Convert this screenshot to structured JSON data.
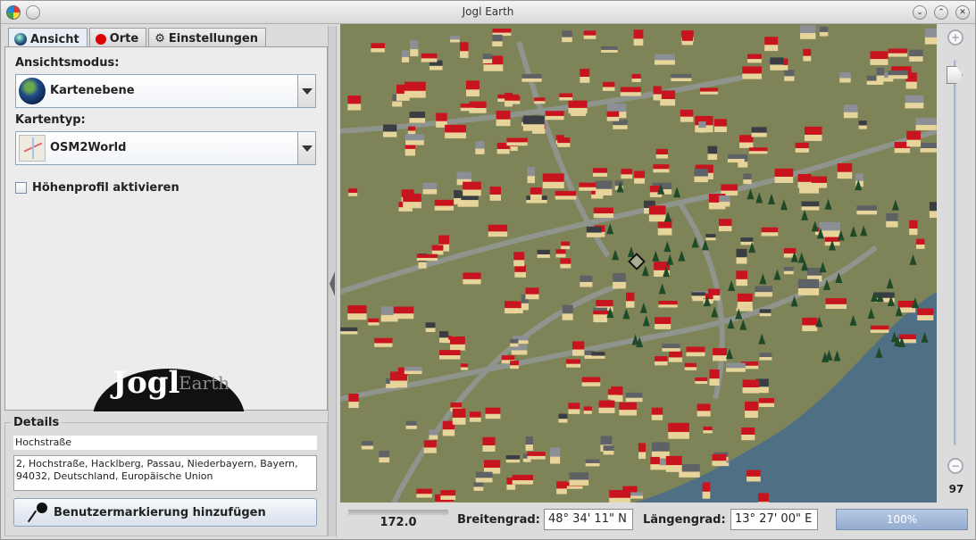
{
  "window": {
    "title": "Jogl Earth"
  },
  "tabs": [
    {
      "label": "Ansicht"
    },
    {
      "label": "Orte"
    },
    {
      "label": "Einstellungen"
    }
  ],
  "view": {
    "mode_label": "Ansichtsmodus:",
    "mode_value": "Kartenebene",
    "maptype_label": "Kartentyp:",
    "maptype_value": "OSM2World",
    "elevation_label": "Höhenprofil aktivieren",
    "elevation_checked": false
  },
  "logo": {
    "word1": "Jogl",
    "word2": "Earth"
  },
  "details": {
    "legend": "Details",
    "name": "Hochstraße",
    "address": "2, Hochstraße, Hacklberg, Passau, Niederbayern, Bayern, 94032, Deutschland, Europäische Union",
    "add_marker_label": "Benutzermarkierung hinzufügen"
  },
  "zoom": {
    "value": "97",
    "slider_fraction": 0.97
  },
  "statusbar": {
    "scale_value": "172.0",
    "lat_label": "Breitengrad:",
    "lat_value": "48° 34' 11\" N",
    "lon_label": "Längengrad:",
    "lon_value": "13° 27' 00\" E",
    "progress_text": "100%",
    "progress_fraction": 1.0
  },
  "icons": {
    "app": "app-icon",
    "tab_ansicht": "globe-icon",
    "tab_orte": "pin-icon",
    "tab_einstellungen": "gear-icon",
    "zoom_in": "zoom-in-icon",
    "zoom_out": "zoom-out-icon"
  },
  "colors": {
    "roof_red": "#c8141e",
    "terrain": "#7e8458",
    "river": "#4e6f84",
    "tree": "#1f4a2a"
  }
}
